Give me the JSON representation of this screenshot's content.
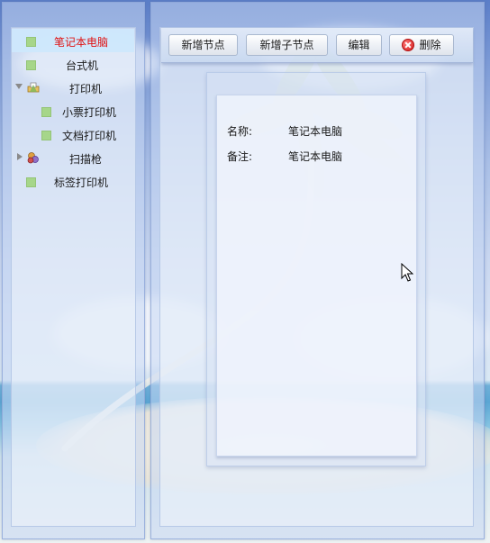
{
  "tree": {
    "items": [
      {
        "label": "笔记本电脑",
        "selected": true,
        "icon": "leaf-icon"
      },
      {
        "label": "台式机",
        "icon": "leaf-icon"
      },
      {
        "label": "打印机",
        "expanded": true,
        "icon": "printer-group-icon"
      },
      {
        "label": "小票打印机",
        "icon": "leaf-icon"
      },
      {
        "label": "文档打印机",
        "icon": "leaf-icon"
      },
      {
        "label": "扫描枪",
        "expanded": false,
        "icon": "scanner-group-icon"
      },
      {
        "label": "标签打印机",
        "icon": "leaf-icon"
      }
    ]
  },
  "toolbar": {
    "add_node_label": "新增节点",
    "add_child_label": "新增子节点",
    "edit_label": "编辑",
    "delete_label": "删除",
    "delete_icon": "delete-icon"
  },
  "detail": {
    "name_label": "名称:",
    "name_value": "笔记本电脑",
    "note_label": "备注:",
    "note_value": "笔记本电脑"
  },
  "colors": {
    "selected_text": "#e01010",
    "selected_bg": "#cde8fc",
    "leaf_icon": "#a6d68a"
  }
}
